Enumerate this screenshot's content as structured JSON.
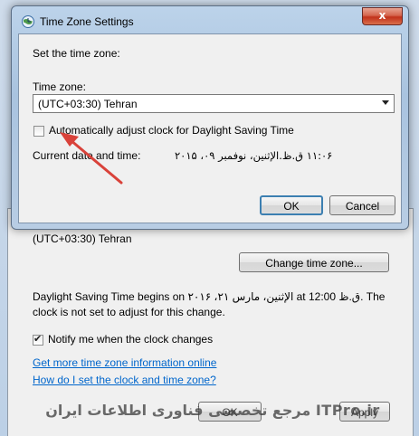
{
  "dialog": {
    "title": "Time Zone Settings",
    "close_label": "x",
    "instruction": "Set the time zone:",
    "timezone_label": "Time zone:",
    "timezone_value": "(UTC+03:30) Tehran",
    "dst_checkbox_label": "Automatically adjust clock for Daylight Saving Time",
    "dst_checked": false,
    "current_label": "Current date and time:",
    "current_value": "۱۱:۰۶ ق.ظ.الإثنين، نوفمبر ۰۹، ۲۰۱۵",
    "ok_label": "OK",
    "cancel_label": "Cancel"
  },
  "background": {
    "timezone_value": "(UTC+03:30) Tehran",
    "change_button_label": "Change time zone...",
    "dst_text": "Daylight Saving Time begins on الإثنين، مارس ۲۱، ۲۰۱۶ at 12:00 ق.ظ. The clock is not set to adjust for this change.",
    "notify_label": "Notify me when the clock changes",
    "notify_checked": true,
    "link_online": "Get more time zone information online",
    "link_howto": "How do I set the clock and time zone?",
    "ok_label": "OK",
    "apply_label": "Apply"
  },
  "watermark": "مرجع تخصصی فناوری اطلاعات ایران ITPro.ir",
  "colors": {
    "link": "#0066cc",
    "annotation_arrow": "#d9423a",
    "title_bar": "#a9c3df",
    "close_button": "#c1311a"
  }
}
